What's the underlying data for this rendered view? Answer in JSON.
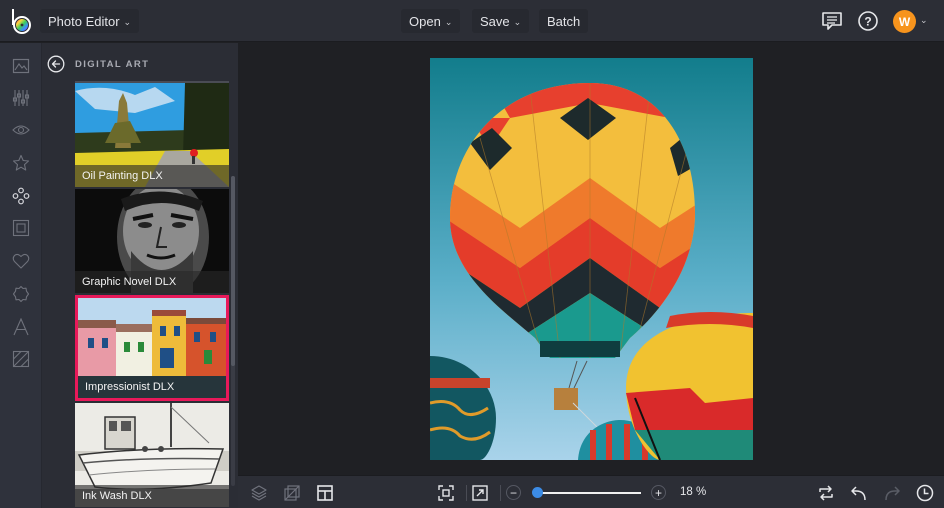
{
  "header": {
    "app_menu_label": "Photo Editor",
    "open_label": "Open",
    "save_label": "Save",
    "batch_label": "Batch",
    "avatar_initial": "W",
    "avatar_color": "#f7941d",
    "icons": [
      "logo-icon",
      "feedback-icon",
      "help-icon",
      "chevron-down-icon"
    ]
  },
  "rail": {
    "items": [
      {
        "name": "image-icon",
        "label": "Image"
      },
      {
        "name": "adjustments-icon",
        "label": "Edit"
      },
      {
        "name": "eye-icon",
        "label": "Touch Up"
      },
      {
        "name": "star-icon",
        "label": "Effects"
      },
      {
        "name": "artsy-icon",
        "label": "Artsy",
        "active": true
      },
      {
        "name": "frame-icon",
        "label": "Frames"
      },
      {
        "name": "heart-icon",
        "label": "Overlays"
      },
      {
        "name": "badge-icon",
        "label": "Graphics"
      },
      {
        "name": "text-icon",
        "label": "Text"
      },
      {
        "name": "texture-icon",
        "label": "Textures"
      }
    ]
  },
  "panel": {
    "title": "DIGITAL ART",
    "thumbs": [
      {
        "label": "Oil Painting DLX",
        "selected": false
      },
      {
        "label": "Graphic Novel DLX",
        "selected": false
      },
      {
        "label": "Impressionist DLX",
        "selected": true
      },
      {
        "label": "Ink Wash DLX",
        "selected": false
      }
    ],
    "selection_color": "#e8195a"
  },
  "canvas": {
    "image_description": "Hot air balloons against blue sky"
  },
  "bottombar": {
    "zoom_value": "18 %",
    "zoom_fraction": 0.04,
    "slider_color": "#3c8ce6",
    "zoom_minus": "−",
    "zoom_plus": "+"
  }
}
